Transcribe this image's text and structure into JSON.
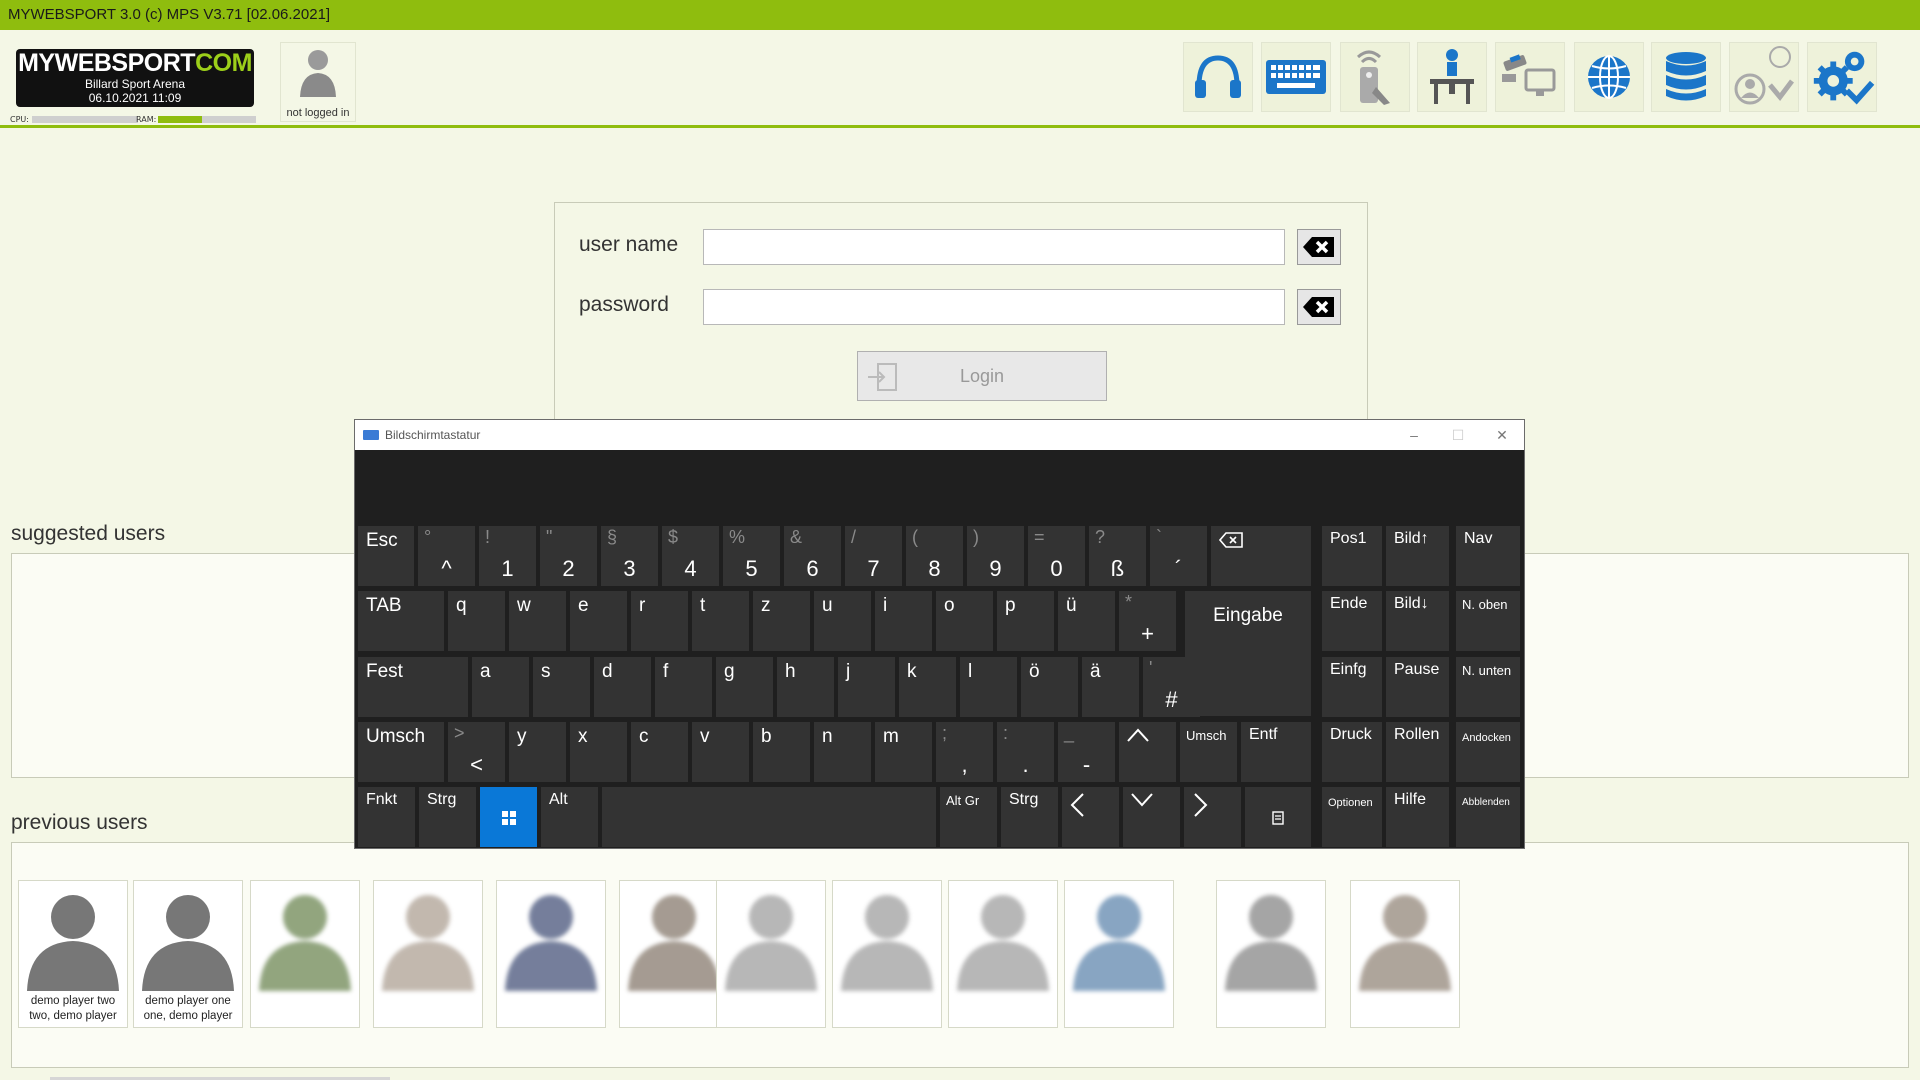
{
  "titlebar": {
    "text": "MYWEBSPORT 3.0  (c) MPS V3.71 [02.06.2021]"
  },
  "header": {
    "logo": {
      "brand_main": "MYWEBSPORT",
      "brand_suffix": "COM",
      "venue": "Billard Sport Arena",
      "datetime": "06.10.2021  11:09"
    },
    "meters": {
      "cpu_label": "CPU:",
      "ram_label": "RAM:",
      "cpu_level": 0.0,
      "ram_level": 0.45
    },
    "user_status": "not logged in",
    "toolbar": [
      {
        "icon": "headset-icon"
      },
      {
        "icon": "keyboard-icon"
      },
      {
        "icon": "remote-control-icon"
      },
      {
        "icon": "referee-table-icon"
      },
      {
        "icon": "camera-monitor-icon"
      },
      {
        "icon": "globe-icon"
      },
      {
        "icon": "database-icon"
      },
      {
        "icon": "user-check-icon"
      },
      {
        "icon": "settings-check-icon"
      }
    ]
  },
  "login": {
    "username_label": "user name",
    "password_label": "password",
    "username_value": "",
    "password_value": "",
    "login_label": "Login"
  },
  "suggested_title": "suggested users",
  "previous_title": "previous users",
  "previous_users": [
    {
      "caption": "demo player two two, demo player",
      "blurred": false
    },
    {
      "caption": "demo player one one, demo player",
      "blurred": false
    },
    {
      "caption": "",
      "blurred": true
    },
    {
      "caption": "",
      "blurred": true
    },
    {
      "caption": "",
      "blurred": true
    },
    {
      "caption": "",
      "blurred": true
    },
    {
      "caption": "",
      "blurred": true
    },
    {
      "caption": "",
      "blurred": true
    },
    {
      "caption": "",
      "blurred": true
    },
    {
      "caption": "",
      "blurred": true
    },
    {
      "caption": "",
      "blurred": true
    },
    {
      "caption": "",
      "blurred": true
    }
  ],
  "osk": {
    "title": "Bildschirmtastatur",
    "controls": {
      "minimize": "–",
      "maximize": "☐",
      "close": "✕"
    },
    "keys": {
      "esc": "Esc",
      "tab": "TAB",
      "fest": "Fest",
      "umsch": "Umsch",
      "fnkt": "Fnkt",
      "strg": "Strg",
      "alt": "Alt",
      "altgr": "Alt Gr",
      "strg_r": "Strg",
      "eingabe": "Eingabe",
      "umsch_r": "Umsch",
      "entf": "Entf",
      "pos1": "Pos1",
      "bild_up": "Bild↑",
      "nav": "Nav",
      "ende": "Ende",
      "bild_down": "Bild↓",
      "n_oben": "N. oben",
      "einfg": "Einfg",
      "pause": "Pause",
      "n_unten": "N. unten",
      "druck": "Druck",
      "rollen": "Rollen",
      "andocken": "Andocken",
      "optionen": "Optionen",
      "hilfe": "Hilfe",
      "abblenden": "Abblenden",
      "num_row": [
        {
          "shift": "°",
          "base": "^"
        },
        {
          "shift": "!",
          "base": "1"
        },
        {
          "shift": "\"",
          "base": "2"
        },
        {
          "shift": "§",
          "base": "3"
        },
        {
          "shift": "$",
          "base": "4"
        },
        {
          "shift": "%",
          "base": "5"
        },
        {
          "shift": "&",
          "base": "6"
        },
        {
          "shift": "/",
          "base": "7"
        },
        {
          "shift": "(",
          "base": "8"
        },
        {
          "shift": ")",
          "base": "9"
        },
        {
          "shift": "=",
          "base": "0"
        },
        {
          "shift": "?",
          "base": "ß"
        },
        {
          "shift": "`",
          "base": "´"
        }
      ],
      "q_row": [
        "q",
        "w",
        "e",
        "r",
        "t",
        "z",
        "u",
        "i",
        "o",
        "p",
        "ü"
      ],
      "q_row_last": {
        "shift": "*",
        "base": "+"
      },
      "a_row": [
        "a",
        "s",
        "d",
        "f",
        "g",
        "h",
        "j",
        "k",
        "l",
        "ö",
        "ä"
      ],
      "a_row_last": {
        "shift": "'",
        "base": "#"
      },
      "y_row_first": {
        "shift": ">",
        "base": "<"
      },
      "y_row": [
        "y",
        "x",
        "c",
        "v",
        "b",
        "n",
        "m"
      ],
      "y_row_punct": [
        {
          "shift": ";",
          "base": ","
        },
        {
          "shift": ":",
          "base": "."
        },
        {
          "shift": "_",
          "base": "-"
        }
      ]
    }
  }
}
